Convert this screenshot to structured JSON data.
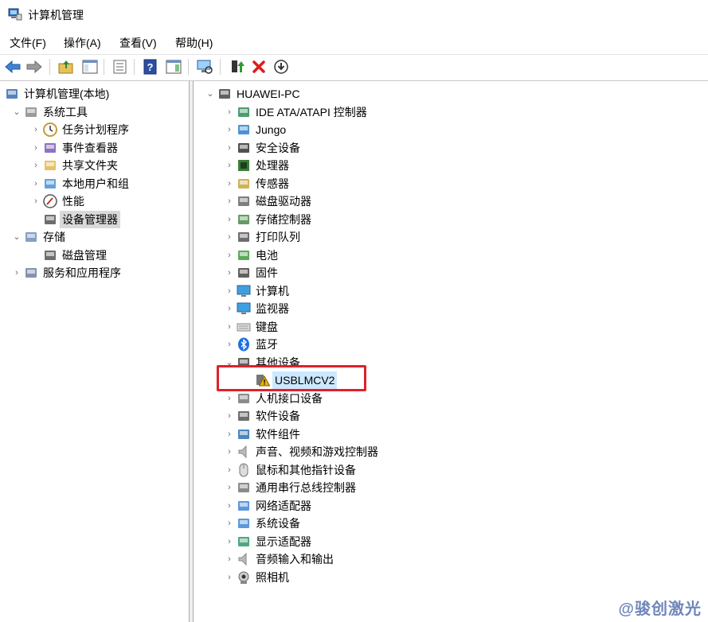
{
  "window": {
    "title": "计算机管理"
  },
  "menu": [
    "文件(F)",
    "操作(A)",
    "查看(V)",
    "帮助(H)"
  ],
  "toolbar": [
    {
      "name": "back-arrow-icon"
    },
    {
      "name": "forward-arrow-icon"
    },
    {
      "name": "up-folder-icon"
    },
    {
      "name": "show-hide-tree-icon"
    },
    {
      "name": "export-list-icon"
    },
    {
      "name": "help-icon"
    },
    {
      "name": "action-pane-icon"
    },
    {
      "name": "scan-hardware-icon"
    },
    {
      "name": "update-driver-icon"
    },
    {
      "name": "uninstall-icon"
    },
    {
      "name": "disable-device-icon"
    }
  ],
  "left_tree": [
    {
      "label": "计算机管理(本地)",
      "level": 0,
      "chev": "",
      "icon": "computer-management-icon"
    },
    {
      "label": "系统工具",
      "level": 1,
      "chev": "open",
      "icon": "tools-icon"
    },
    {
      "label": "任务计划程序",
      "level": 2,
      "chev": "closed",
      "icon": "clock-icon"
    },
    {
      "label": "事件查看器",
      "level": 2,
      "chev": "closed",
      "icon": "event-viewer-icon"
    },
    {
      "label": "共享文件夹",
      "level": 2,
      "chev": "closed",
      "icon": "shared-folder-icon"
    },
    {
      "label": "本地用户和组",
      "level": 2,
      "chev": "closed",
      "icon": "users-icon"
    },
    {
      "label": "性能",
      "level": 2,
      "chev": "closed",
      "icon": "performance-icon"
    },
    {
      "label": "设备管理器",
      "level": 2,
      "chev": "",
      "icon": "device-manager-icon",
      "selected": true
    },
    {
      "label": "存储",
      "level": 1,
      "chev": "open",
      "icon": "storage-icon"
    },
    {
      "label": "磁盘管理",
      "level": 2,
      "chev": "",
      "icon": "disk-icon"
    },
    {
      "label": "服务和应用程序",
      "level": 1,
      "chev": "closed",
      "icon": "services-icon"
    }
  ],
  "right_tree": [
    {
      "label": "HUAWEI-PC",
      "level": 0,
      "chev": "open",
      "icon": "pc-icon"
    },
    {
      "label": "IDE ATA/ATAPI 控制器",
      "level": 1,
      "chev": "closed",
      "icon": "ide-controller-icon"
    },
    {
      "label": "Jungo",
      "level": 1,
      "chev": "closed",
      "icon": "jungo-icon"
    },
    {
      "label": "安全设备",
      "level": 1,
      "chev": "closed",
      "icon": "security-device-icon"
    },
    {
      "label": "处理器",
      "level": 1,
      "chev": "closed",
      "icon": "processor-icon"
    },
    {
      "label": "传感器",
      "level": 1,
      "chev": "closed",
      "icon": "sensor-icon"
    },
    {
      "label": "磁盘驱动器",
      "level": 1,
      "chev": "closed",
      "icon": "disk-drive-icon"
    },
    {
      "label": "存储控制器",
      "level": 1,
      "chev": "closed",
      "icon": "storage-controller-icon"
    },
    {
      "label": "打印队列",
      "level": 1,
      "chev": "closed",
      "icon": "printer-icon"
    },
    {
      "label": "电池",
      "level": 1,
      "chev": "closed",
      "icon": "battery-icon"
    },
    {
      "label": "固件",
      "level": 1,
      "chev": "closed",
      "icon": "firmware-icon"
    },
    {
      "label": "计算机",
      "level": 1,
      "chev": "closed",
      "icon": "computer-icon"
    },
    {
      "label": "监视器",
      "level": 1,
      "chev": "closed",
      "icon": "monitor-icon"
    },
    {
      "label": "键盘",
      "level": 1,
      "chev": "closed",
      "icon": "keyboard-icon"
    },
    {
      "label": "蓝牙",
      "level": 1,
      "chev": "closed",
      "icon": "bluetooth-icon"
    },
    {
      "label": "其他设备",
      "level": 1,
      "chev": "open",
      "icon": "other-devices-icon"
    },
    {
      "label": "USBLMCV2",
      "level": 2,
      "chev": "",
      "icon": "warning-device-icon",
      "selected": true
    },
    {
      "label": "人机接口设备",
      "level": 1,
      "chev": "closed",
      "icon": "hid-icon"
    },
    {
      "label": "软件设备",
      "level": 1,
      "chev": "closed",
      "icon": "software-device-icon"
    },
    {
      "label": "软件组件",
      "level": 1,
      "chev": "closed",
      "icon": "software-component-icon"
    },
    {
      "label": "声音、视频和游戏控制器",
      "level": 1,
      "chev": "closed",
      "icon": "sound-icon"
    },
    {
      "label": "鼠标和其他指针设备",
      "level": 1,
      "chev": "closed",
      "icon": "mouse-icon"
    },
    {
      "label": "通用串行总线控制器",
      "level": 1,
      "chev": "closed",
      "icon": "usb-icon"
    },
    {
      "label": "网络适配器",
      "level": 1,
      "chev": "closed",
      "icon": "network-adapter-icon"
    },
    {
      "label": "系统设备",
      "level": 1,
      "chev": "closed",
      "icon": "system-device-icon"
    },
    {
      "label": "显示适配器",
      "level": 1,
      "chev": "closed",
      "icon": "display-adapter-icon"
    },
    {
      "label": "音频输入和输出",
      "level": 1,
      "chev": "closed",
      "icon": "audio-io-icon"
    },
    {
      "label": "照相机",
      "level": 1,
      "chev": "closed",
      "icon": "camera-icon"
    }
  ],
  "watermark": "@骏创激光"
}
